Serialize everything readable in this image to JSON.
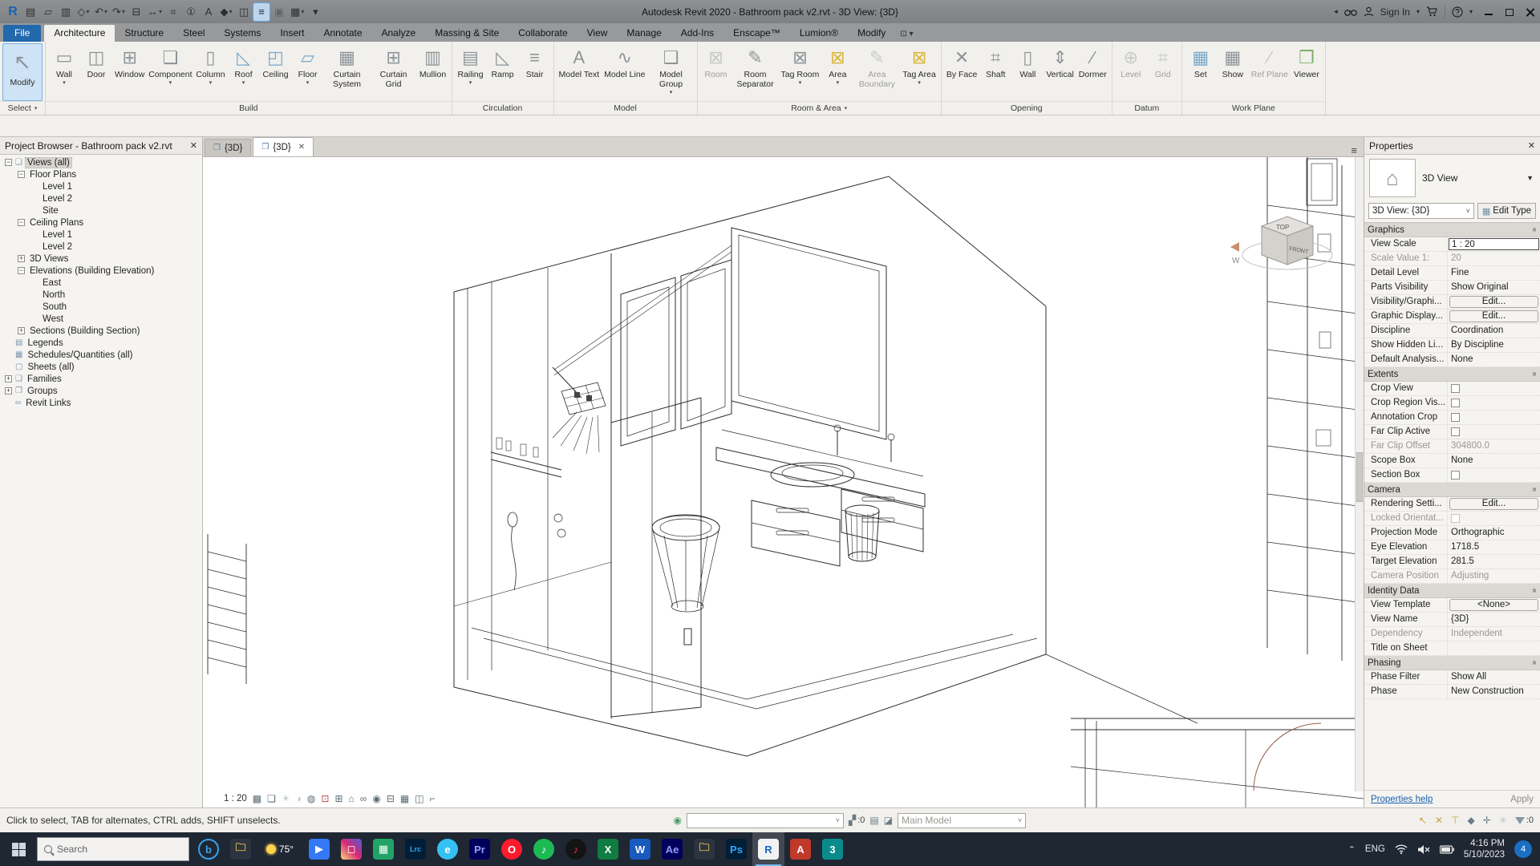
{
  "window": {
    "title": "Autodesk Revit 2020 - Bathroom pack v2.rvt - 3D View: {3D}",
    "signin_label": "Sign In",
    "qat": [
      {
        "name": "revit-logo",
        "glyph": "R",
        "logo": true
      },
      {
        "name": "file-manager-icon",
        "glyph": "▤"
      },
      {
        "name": "open-icon",
        "glyph": "▱"
      },
      {
        "name": "save-icon",
        "glyph": "▥"
      },
      {
        "name": "sync-icon",
        "glyph": "◇",
        "drop": true
      },
      {
        "name": "undo-icon",
        "glyph": "↶",
        "drop": true
      },
      {
        "name": "redo-icon",
        "glyph": "↷",
        "drop": true
      },
      {
        "name": "print-icon",
        "glyph": "⊟"
      },
      {
        "name": "measure-icon",
        "glyph": "↔",
        "drop": true
      },
      {
        "name": "aligned-dimension-icon",
        "glyph": "⌗"
      },
      {
        "name": "tag-icon",
        "glyph": "①"
      },
      {
        "name": "text-icon",
        "glyph": "A"
      },
      {
        "name": "default-3d-view-icon",
        "glyph": "◆",
        "drop": true
      },
      {
        "name": "section-icon",
        "glyph": "◫"
      },
      {
        "name": "thin-lines-icon",
        "glyph": "≡",
        "highlighted": true
      },
      {
        "name": "close-hidden-windows-icon",
        "glyph": "▣",
        "disabled": true
      },
      {
        "name": "switch-windows-icon",
        "glyph": "▦",
        "drop": true
      },
      {
        "name": "customize-qat-icon",
        "glyph": "▾"
      }
    ]
  },
  "ribbon": {
    "tabs": [
      {
        "label": "File",
        "kind": "file"
      },
      {
        "label": "Architecture",
        "kind": "active"
      },
      {
        "label": "Structure"
      },
      {
        "label": "Steel"
      },
      {
        "label": "Systems"
      },
      {
        "label": "Insert"
      },
      {
        "label": "Annotate"
      },
      {
        "label": "Analyze"
      },
      {
        "label": "Massing & Site"
      },
      {
        "label": "Collaborate"
      },
      {
        "label": "View"
      },
      {
        "label": "Manage"
      },
      {
        "label": "Add-Ins"
      },
      {
        "label": "Enscape™"
      },
      {
        "label": "Lumion®"
      },
      {
        "label": "Modify"
      },
      {
        "label": "⊡ ▾",
        "kind": "toggle",
        "name": "ribbon-display-toggle"
      }
    ],
    "panels": [
      {
        "label": "Select",
        "drop": true,
        "buttons": [
          {
            "label": "Modify",
            "glyph": "↖",
            "big": true,
            "selected": true
          }
        ]
      },
      {
        "label": "Build",
        "buttons": [
          {
            "label": "Wall",
            "glyph": "▭",
            "drop": true
          },
          {
            "label": "Door",
            "glyph": "◫"
          },
          {
            "label": "Window",
            "glyph": "⊞"
          },
          {
            "label": "Component",
            "glyph": "❏",
            "drop": true
          },
          {
            "label": "Column",
            "glyph": "▯",
            "drop": true
          },
          {
            "label": "Roof",
            "glyph": "◺",
            "drop": true,
            "tint": "blue"
          },
          {
            "label": "Ceiling",
            "glyph": "◰",
            "tint": "blue"
          },
          {
            "label": "Floor",
            "glyph": "▱",
            "drop": true,
            "tint": "blue"
          },
          {
            "label": "Curtain System",
            "glyph": "▦"
          },
          {
            "label": "Curtain Grid",
            "glyph": "⊞"
          },
          {
            "label": "Mullion",
            "glyph": "▥"
          }
        ]
      },
      {
        "label": "Circulation",
        "buttons": [
          {
            "label": "Railing",
            "glyph": "▤",
            "drop": true
          },
          {
            "label": "Ramp",
            "glyph": "◺"
          },
          {
            "label": "Stair",
            "glyph": "≡"
          }
        ]
      },
      {
        "label": "Model",
        "buttons": [
          {
            "label": "Model Text",
            "glyph": "A"
          },
          {
            "label": "Model Line",
            "glyph": "∿"
          },
          {
            "label": "Model Group",
            "glyph": "❑",
            "drop": true
          }
        ]
      },
      {
        "label": "Room & Area",
        "drop": true,
        "buttons": [
          {
            "label": "Room",
            "glyph": "⊠",
            "disabled": true
          },
          {
            "label": "Room Separator",
            "glyph": "✎"
          },
          {
            "label": "Tag Room",
            "glyph": "⊠",
            "drop": true
          },
          {
            "label": "Area",
            "glyph": "⊠",
            "drop": true,
            "tint": "yellow"
          },
          {
            "label": "Area Boundary",
            "glyph": "✎",
            "disabled": true
          },
          {
            "label": "Tag Area",
            "glyph": "⊠",
            "drop": true,
            "tint": "yellow"
          }
        ]
      },
      {
        "label": "Opening",
        "buttons": [
          {
            "label": "By Face",
            "glyph": "✕"
          },
          {
            "label": "Shaft",
            "glyph": "⌗"
          },
          {
            "label": "Wall",
            "glyph": "▯"
          },
          {
            "label": "Vertical",
            "glyph": "⇕"
          },
          {
            "label": "Dormer",
            "glyph": "∕"
          }
        ]
      },
      {
        "label": "Datum",
        "buttons": [
          {
            "label": "Level",
            "glyph": "⊕",
            "disabled": true
          },
          {
            "label": "Grid",
            "glyph": "⌗",
            "disabled": true
          }
        ]
      },
      {
        "label": "Work Plane",
        "buttons": [
          {
            "label": "Set",
            "glyph": "▦",
            "tint": "blue"
          },
          {
            "label": "Show",
            "glyph": "▦"
          },
          {
            "label": "Ref Plane",
            "glyph": "∕",
            "disabled": true
          },
          {
            "label": "Viewer",
            "glyph": "❒",
            "tint": "green"
          }
        ]
      }
    ]
  },
  "docTabs": {
    "tabs": [
      {
        "label": "{3D}",
        "active": false
      },
      {
        "label": "{3D}",
        "active": true,
        "close": true
      }
    ],
    "list_icon": "≡"
  },
  "projectBrowser": {
    "header": "Project Browser - Bathroom pack v2.rvt",
    "items": [
      {
        "label": "Views (all)",
        "depth": 0,
        "exp": "minus",
        "icon": "❏",
        "selected": true
      },
      {
        "label": "Floor Plans",
        "depth": 1,
        "exp": "minus"
      },
      {
        "label": "Level 1",
        "depth": 2
      },
      {
        "label": "Level 2",
        "depth": 2
      },
      {
        "label": "Site",
        "depth": 2
      },
      {
        "label": "Ceiling Plans",
        "depth": 1,
        "exp": "minus"
      },
      {
        "label": "Level 1",
        "depth": 2
      },
      {
        "label": "Level 2",
        "depth": 2
      },
      {
        "label": "3D Views",
        "depth": 1,
        "exp": "plus"
      },
      {
        "label": "Elevations (Building Elevation)",
        "depth": 1,
        "exp": "minus"
      },
      {
        "label": "East",
        "depth": 2
      },
      {
        "label": "North",
        "depth": 2
      },
      {
        "label": "South",
        "depth": 2
      },
      {
        "label": "West",
        "depth": 2
      },
      {
        "label": "Sections (Building Section)",
        "depth": 1,
        "exp": "plus"
      },
      {
        "label": "Legends",
        "depth": 0,
        "icon": "▤"
      },
      {
        "label": "Schedules/Quantities (all)",
        "depth": 0,
        "icon": "▦"
      },
      {
        "label": "Sheets (all)",
        "depth": 0,
        "icon": "▢"
      },
      {
        "label": "Families",
        "depth": 0,
        "exp": "plus",
        "icon": "❑"
      },
      {
        "label": "Groups",
        "depth": 0,
        "exp": "plus",
        "icon": "❒"
      },
      {
        "label": "Revit Links",
        "depth": 0,
        "icon": "∞"
      }
    ]
  },
  "properties": {
    "title": "Properties",
    "type_label": "3D View",
    "type_glyph": "⌂",
    "combo": "3D View: {3D}",
    "edit_type": "Edit Type",
    "rows": [
      {
        "kind": "section",
        "label": "Graphics"
      },
      {
        "label": "View Scale",
        "value": "1 : 20",
        "vkind": "input"
      },
      {
        "label": "Scale Value    1:",
        "value": "20",
        "dim": true,
        "vdim": true
      },
      {
        "label": "Detail Level",
        "value": "Fine"
      },
      {
        "label": "Parts Visibility",
        "value": "Show Original"
      },
      {
        "label": "Visibility/Graphi...",
        "value": "Edit...",
        "vkind": "button"
      },
      {
        "label": "Graphic Display...",
        "value": "Edit...",
        "vkind": "button"
      },
      {
        "label": "Discipline",
        "value": "Coordination"
      },
      {
        "label": "Show Hidden Li...",
        "value": "By Discipline"
      },
      {
        "label": "Default Analysis...",
        "value": "None"
      },
      {
        "kind": "section",
        "label": "Extents"
      },
      {
        "label": "Crop View",
        "vkind": "check"
      },
      {
        "label": "Crop Region Vis...",
        "vkind": "check"
      },
      {
        "label": "Annotation Crop",
        "vkind": "check"
      },
      {
        "label": "Far Clip Active",
        "vkind": "check"
      },
      {
        "label": "Far Clip Offset",
        "value": "304800.0",
        "dim": true,
        "vdim": true
      },
      {
        "label": "Scope Box",
        "value": "None"
      },
      {
        "label": "Section Box",
        "vkind": "check"
      },
      {
        "kind": "section",
        "label": "Camera"
      },
      {
        "label": "Rendering Setti...",
        "value": "Edit...",
        "vkind": "button"
      },
      {
        "label": "Locked Orientat...",
        "vkind": "check",
        "dim": true,
        "vdim": true
      },
      {
        "label": "Projection Mode",
        "value": "Orthographic"
      },
      {
        "label": "Eye Elevation",
        "value": "1718.5"
      },
      {
        "label": "Target Elevation",
        "value": "281.5"
      },
      {
        "label": "Camera Position",
        "value": "Adjusting",
        "dim": true,
        "vdim": true
      },
      {
        "kind": "section",
        "label": "Identity Data"
      },
      {
        "label": "View Template",
        "value": "<None>",
        "vkind": "button"
      },
      {
        "label": "View Name",
        "value": "{3D}"
      },
      {
        "label": "Dependency",
        "value": "Independent",
        "dim": true,
        "vdim": true
      },
      {
        "label": "Title on Sheet",
        "value": ""
      },
      {
        "kind": "section",
        "label": "Phasing"
      },
      {
        "label": "Phase Filter",
        "value": "Show All"
      },
      {
        "label": "Phase",
        "value": "New Construction"
      }
    ],
    "footer": {
      "help": "Properties help",
      "apply": "Apply"
    }
  },
  "viewcube": {
    "top": "TOP",
    "front": "FRONT",
    "west": "W"
  },
  "viewbar": {
    "scale": "1 : 20",
    "icons": [
      {
        "name": "detail-level-icon",
        "glyph": "▩"
      },
      {
        "name": "visual-style-icon",
        "glyph": "❏"
      },
      {
        "name": "sun-path-icon",
        "glyph": "☀",
        "dim": true
      },
      {
        "name": "shadows-icon",
        "glyph": "◑",
        "dim": true
      },
      {
        "name": "render-icon",
        "glyph": "◍"
      },
      {
        "name": "crop-view-icon",
        "glyph": "⊡",
        "red": true
      },
      {
        "name": "crop-region-icon",
        "glyph": "⊞"
      },
      {
        "name": "unlocked-view-icon",
        "glyph": "⌂"
      },
      {
        "name": "hide-isolate-icon",
        "glyph": "∞"
      },
      {
        "name": "reveal-hidden-icon",
        "glyph": "◉"
      },
      {
        "name": "temp-view-properties-icon",
        "glyph": "⊟"
      },
      {
        "name": "worksharing-display-icon",
        "glyph": "▦"
      },
      {
        "name": "displaced-elements-icon",
        "glyph": "◫"
      },
      {
        "name": "constraints-icon",
        "glyph": "⌐"
      }
    ]
  },
  "statusBar": {
    "hint": "Click to select, TAB for alternates, CTRL adds, SHIFT unselects.",
    "design_option_icon": "◉",
    "mid_icons": [
      {
        "name": "worksets-icon",
        "glyph": "▞",
        "count": ":0"
      },
      {
        "name": "worksets-dialog-icon",
        "glyph": "▤"
      },
      {
        "name": "design-options-icon",
        "glyph": "◪"
      }
    ],
    "main_model": "Main Model",
    "right_icons": [
      {
        "name": "select-links-icon",
        "glyph": "↖",
        "tint": "yellow"
      },
      {
        "name": "exclude-options-icon",
        "glyph": "✕",
        "tint": "yellow"
      },
      {
        "name": "select-pinned-icon",
        "glyph": "⊤",
        "tint": "yellow"
      },
      {
        "name": "select-by-face-icon",
        "glyph": "◆"
      },
      {
        "name": "drag-on-selection-icon",
        "glyph": "✛"
      },
      {
        "name": "settings-gear-icon",
        "glyph": "✳",
        "dim": true
      }
    ],
    "filter_count": ":0"
  },
  "taskbar": {
    "search_placeholder": "Search",
    "apps": [
      {
        "name": "cortana",
        "label": "b",
        "bg": "transparent",
        "fg": "#35a3e8",
        "circle": true,
        "ring": true
      },
      {
        "name": "file-explorer",
        "label": "🗀",
        "bg": "#2b3440",
        "fg": "#f3c64b"
      },
      {
        "name": "weather",
        "kind": "weather",
        "temp": "75°"
      },
      {
        "name": "video-app",
        "label": "▶",
        "bg": "#3478f6",
        "fg": "#ffffff"
      },
      {
        "name": "instagram",
        "label": "◻",
        "bg": "linear-gradient(45deg,#feda75,#d62976,#4f5bd5)",
        "fg": "#ffffff"
      },
      {
        "name": "sheets",
        "label": "▦",
        "bg": "#21a366",
        "fg": "#ffffff"
      },
      {
        "name": "lightroom",
        "label": "Lrc",
        "bg": "#001e36",
        "fg": "#31a8ff",
        "small": true
      },
      {
        "name": "edge",
        "label": "e",
        "bg": "#35c1f1",
        "fg": "#ffffff",
        "circle": true
      },
      {
        "name": "premiere",
        "label": "Pr",
        "bg": "#00005b",
        "fg": "#9999ff"
      },
      {
        "name": "opera",
        "label": "O",
        "bg": "#ff1b2d",
        "fg": "#ffffff",
        "circle": true
      },
      {
        "name": "spotify",
        "label": "♪",
        "bg": "#1db954",
        "fg": "#ffffff",
        "circle": true
      },
      {
        "name": "music",
        "label": "♪",
        "bg": "#141414",
        "fg": "#fa2d48",
        "circle": true
      },
      {
        "name": "excel",
        "label": "X",
        "bg": "#107c41",
        "fg": "#ffffff"
      },
      {
        "name": "word",
        "label": "W",
        "bg": "#185abd",
        "fg": "#ffffff"
      },
      {
        "name": "after-effects",
        "label": "Ae",
        "bg": "#00005b",
        "fg": "#9999ff"
      },
      {
        "name": "folder",
        "label": "🗀",
        "bg": "#2b3440",
        "fg": "#f3c64b"
      },
      {
        "name": "photoshop",
        "label": "Ps",
        "bg": "#001e36",
        "fg": "#31a8ff"
      },
      {
        "name": "revit",
        "label": "R",
        "bg": "#f2f2f2",
        "fg": "#1565c0",
        "active": true
      },
      {
        "name": "autocad",
        "label": "A",
        "bg": "#c0392b",
        "fg": "#ffffff"
      },
      {
        "name": "3ds-max",
        "label": "3",
        "bg": "#0a8b8b",
        "fg": "#ffffff"
      }
    ],
    "tray": {
      "caret": "⌃",
      "lang": "ENG",
      "time": "4:16 PM",
      "date": "5/10/2023",
      "badge": "4"
    }
  }
}
